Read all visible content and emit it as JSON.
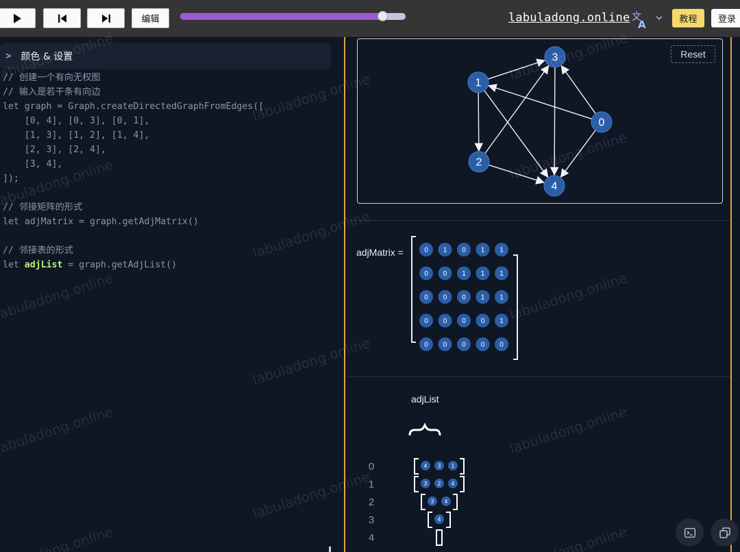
{
  "toolbar": {
    "edit_label": "编辑",
    "progress_fraction": 0.897,
    "site_name": "labuladong.online",
    "tutorial_label": "教程",
    "login_label": "登录",
    "colors": {
      "bar": "#353535",
      "progress_fill": "#9b59d6",
      "tutorial_bg": "#f6d96b"
    }
  },
  "settings": {
    "chevron": ">",
    "label": "颜色 & 设置"
  },
  "code": {
    "lines": [
      "// 创建一个有向无权图",
      "// 输入是若干条有向边",
      "let graph = Graph.createDirectedGraphFromEdges([",
      "    [0, 4], [0, 3], [0, 1],",
      "    [1, 3], [1, 2], [1, 4],",
      "    [2, 3], [2, 4],",
      "    [3, 4],",
      "]);",
      "",
      "// 邻接矩阵的形式",
      "let adjMatrix = graph.getAdjMatrix()",
      "",
      "// 邻接表的形式"
    ],
    "last_line": {
      "kw": "let ",
      "var": "adjList",
      "rest": " = graph.getAdjList()"
    }
  },
  "graph": {
    "reset_label": "Reset",
    "node_color": "#2b5ea7",
    "nodes": [
      {
        "id": "0",
        "label": "0"
      },
      {
        "id": "1",
        "label": "1"
      },
      {
        "id": "2",
        "label": "2"
      },
      {
        "id": "3",
        "label": "3"
      },
      {
        "id": "4",
        "label": "4"
      }
    ],
    "edges": [
      [
        0,
        4
      ],
      [
        0,
        3
      ],
      [
        0,
        1
      ],
      [
        1,
        3
      ],
      [
        1,
        2
      ],
      [
        1,
        4
      ],
      [
        2,
        3
      ],
      [
        2,
        4
      ],
      [
        3,
        4
      ]
    ]
  },
  "matrix": {
    "label": "adjMatrix =",
    "rows": [
      [
        "0",
        "1",
        "0",
        "1",
        "1"
      ],
      [
        "0",
        "0",
        "1",
        "1",
        "1"
      ],
      [
        "0",
        "0",
        "0",
        "1",
        "1"
      ],
      [
        "0",
        "0",
        "0",
        "0",
        "1"
      ],
      [
        "0",
        "0",
        "0",
        "0",
        "0"
      ]
    ]
  },
  "adjlist": {
    "title": "adjList",
    "indices": [
      "0",
      "1",
      "2",
      "3",
      "4"
    ],
    "rows": [
      [
        "4",
        "3",
        "1"
      ],
      [
        "3",
        "2",
        "4"
      ],
      [
        "3",
        "4"
      ],
      [
        "4"
      ],
      []
    ]
  },
  "watermark": "labuladong.online"
}
